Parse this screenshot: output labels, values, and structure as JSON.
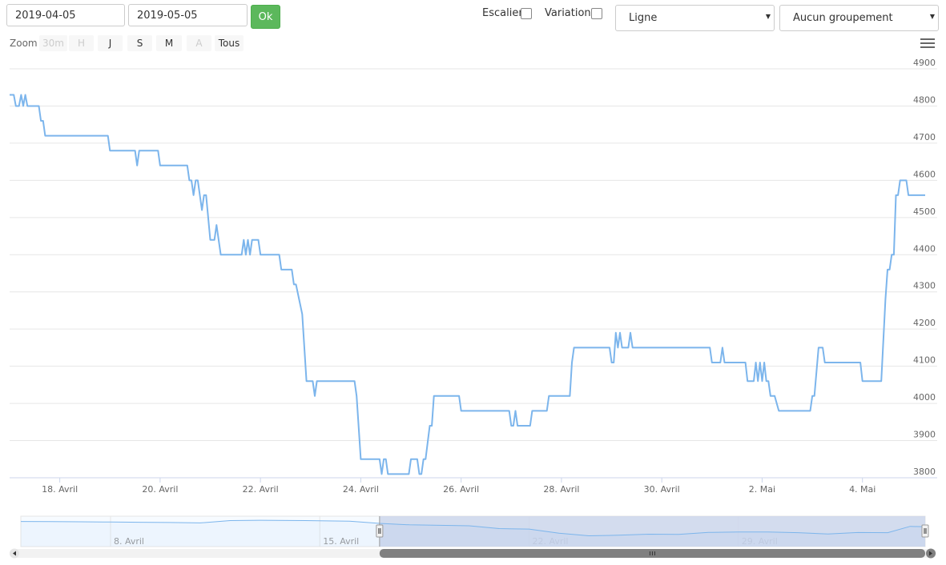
{
  "toolbar": {
    "date_from": "2019-04-05",
    "date_to": "2019-05-05",
    "ok_label": "Ok",
    "escalier_label": "Escalier",
    "variation_label": "Variation",
    "chart_type": "Ligne",
    "grouping": "Aucun groupement"
  },
  "zoom": {
    "label": "Zoom",
    "buttons": [
      {
        "label": "30m",
        "enabled": false
      },
      {
        "label": "H",
        "enabled": false
      },
      {
        "label": "J",
        "enabled": true
      },
      {
        "label": "S",
        "enabled": true
      },
      {
        "label": "M",
        "enabled": true
      },
      {
        "label": "A",
        "enabled": false
      },
      {
        "label": "Tous",
        "enabled": true
      }
    ]
  },
  "colors": {
    "line": "#7cb5ec",
    "navigator_fill": "#ccd6eb",
    "ok_button": "#5cb85c"
  },
  "chart_data": {
    "type": "line",
    "title": "",
    "xlabel": "",
    "ylabel": "",
    "ylim": [
      3800,
      4900
    ],
    "yticks": [
      3800,
      3900,
      4000,
      4100,
      4200,
      4300,
      4400,
      4500,
      4600,
      4700,
      4800,
      4900
    ],
    "xlim": [
      "2019-04-17T00:00",
      "2019-05-05T06:00"
    ],
    "xticks": [
      {
        "date": "2019-04-18",
        "label": "18. Avril"
      },
      {
        "date": "2019-04-20",
        "label": "20. Avril"
      },
      {
        "date": "2019-04-22",
        "label": "22. Avril"
      },
      {
        "date": "2019-04-24",
        "label": "24. Avril"
      },
      {
        "date": "2019-04-26",
        "label": "26. Avril"
      },
      {
        "date": "2019-04-28",
        "label": "28. Avril"
      },
      {
        "date": "2019-04-30",
        "label": "30. Avril"
      },
      {
        "date": "2019-05-02",
        "label": "2. Mai"
      },
      {
        "date": "2019-05-04",
        "label": "4. Mai"
      }
    ],
    "grid": true,
    "legend": "none",
    "series": [
      {
        "points": [
          [
            "2019-04-17T00:00",
            4830
          ],
          [
            "2019-04-17T02:00",
            4830
          ],
          [
            "2019-04-17T03:00",
            4800
          ],
          [
            "2019-04-17T04:30",
            4800
          ],
          [
            "2019-04-17T05:30",
            4830
          ],
          [
            "2019-04-17T06:30",
            4800
          ],
          [
            "2019-04-17T07:30",
            4830
          ],
          [
            "2019-04-17T08:30",
            4800
          ],
          [
            "2019-04-17T14:00",
            4800
          ],
          [
            "2019-04-17T15:00",
            4760
          ],
          [
            "2019-04-17T16:00",
            4760
          ],
          [
            "2019-04-17T17:00",
            4720
          ],
          [
            "2019-04-18T23:00",
            4720
          ],
          [
            "2019-04-19T00:00",
            4680
          ],
          [
            "2019-04-19T12:00",
            4680
          ],
          [
            "2019-04-19T13:00",
            4640
          ],
          [
            "2019-04-19T14:00",
            4680
          ],
          [
            "2019-04-19T23:00",
            4680
          ],
          [
            "2019-04-20T00:00",
            4640
          ],
          [
            "2019-04-20T13:00",
            4640
          ],
          [
            "2019-04-20T14:00",
            4600
          ],
          [
            "2019-04-20T15:00",
            4600
          ],
          [
            "2019-04-20T16:00",
            4560
          ],
          [
            "2019-04-20T17:00",
            4600
          ],
          [
            "2019-04-20T18:00",
            4600
          ],
          [
            "2019-04-20T20:00",
            4520
          ],
          [
            "2019-04-20T21:00",
            4560
          ],
          [
            "2019-04-20T22:00",
            4560
          ],
          [
            "2019-04-21T00:00",
            4440
          ],
          [
            "2019-04-21T02:00",
            4440
          ],
          [
            "2019-04-21T03:00",
            4480
          ],
          [
            "2019-04-21T05:00",
            4400
          ],
          [
            "2019-04-21T15:00",
            4400
          ],
          [
            "2019-04-21T16:00",
            4440
          ],
          [
            "2019-04-21T17:00",
            4400
          ],
          [
            "2019-04-21T18:00",
            4440
          ],
          [
            "2019-04-21T19:00",
            4400
          ],
          [
            "2019-04-21T20:00",
            4440
          ],
          [
            "2019-04-21T23:00",
            4440
          ],
          [
            "2019-04-22T00:00",
            4400
          ],
          [
            "2019-04-22T09:00",
            4400
          ],
          [
            "2019-04-22T10:00",
            4360
          ],
          [
            "2019-04-22T15:00",
            4360
          ],
          [
            "2019-04-22T16:00",
            4320
          ],
          [
            "2019-04-22T17:00",
            4320
          ],
          [
            "2019-04-22T20:00",
            4240
          ],
          [
            "2019-04-22T22:00",
            4060
          ],
          [
            "2019-04-23T01:00",
            4060
          ],
          [
            "2019-04-23T02:00",
            4020
          ],
          [
            "2019-04-23T03:00",
            4060
          ],
          [
            "2019-04-23T21:00",
            4060
          ],
          [
            "2019-04-23T22:00",
            4020
          ],
          [
            "2019-04-24T00:00",
            3850
          ],
          [
            "2019-04-24T09:00",
            3850
          ],
          [
            "2019-04-24T10:00",
            3810
          ],
          [
            "2019-04-24T11:00",
            3850
          ],
          [
            "2019-04-24T12:00",
            3850
          ],
          [
            "2019-04-24T13:00",
            3810
          ],
          [
            "2019-04-24T23:00",
            3810
          ],
          [
            "2019-04-25T00:00",
            3850
          ],
          [
            "2019-04-25T03:00",
            3850
          ],
          [
            "2019-04-25T04:00",
            3810
          ],
          [
            "2019-04-25T05:00",
            3810
          ],
          [
            "2019-04-25T06:00",
            3850
          ],
          [
            "2019-04-25T07:00",
            3850
          ],
          [
            "2019-04-25T09:00",
            3940
          ],
          [
            "2019-04-25T10:00",
            3940
          ],
          [
            "2019-04-25T11:00",
            4020
          ],
          [
            "2019-04-25T23:00",
            4020
          ],
          [
            "2019-04-26T00:00",
            3980
          ],
          [
            "2019-04-26T23:00",
            3980
          ],
          [
            "2019-04-27T00:00",
            3940
          ],
          [
            "2019-04-27T01:00",
            3940
          ],
          [
            "2019-04-27T02:00",
            3980
          ],
          [
            "2019-04-27T03:00",
            3940
          ],
          [
            "2019-04-27T09:00",
            3940
          ],
          [
            "2019-04-27T10:00",
            3980
          ],
          [
            "2019-04-27T17:00",
            3980
          ],
          [
            "2019-04-27T18:00",
            4020
          ],
          [
            "2019-04-28T04:00",
            4020
          ],
          [
            "2019-04-28T05:00",
            4110
          ],
          [
            "2019-04-28T06:00",
            4150
          ],
          [
            "2019-04-28T23:00",
            4150
          ],
          [
            "2019-04-29T00:00",
            4110
          ],
          [
            "2019-04-29T01:00",
            4110
          ],
          [
            "2019-04-29T02:00",
            4190
          ],
          [
            "2019-04-29T03:00",
            4150
          ],
          [
            "2019-04-29T04:00",
            4190
          ],
          [
            "2019-04-29T05:00",
            4150
          ],
          [
            "2019-04-29T08:00",
            4150
          ],
          [
            "2019-04-29T09:00",
            4190
          ],
          [
            "2019-04-29T10:00",
            4150
          ],
          [
            "2019-04-30T23:00",
            4150
          ],
          [
            "2019-05-01T00:00",
            4110
          ],
          [
            "2019-05-01T04:00",
            4110
          ],
          [
            "2019-05-01T05:00",
            4150
          ],
          [
            "2019-05-01T06:00",
            4110
          ],
          [
            "2019-05-01T16:00",
            4110
          ],
          [
            "2019-05-01T17:00",
            4060
          ],
          [
            "2019-05-01T20:00",
            4060
          ],
          [
            "2019-05-01T21:00",
            4110
          ],
          [
            "2019-05-01T22:00",
            4060
          ],
          [
            "2019-05-01T23:00",
            4110
          ],
          [
            "2019-05-02T00:00",
            4060
          ],
          [
            "2019-05-02T01:00",
            4110
          ],
          [
            "2019-05-02T02:00",
            4060
          ],
          [
            "2019-05-02T03:00",
            4060
          ],
          [
            "2019-05-02T04:00",
            4020
          ],
          [
            "2019-05-02T06:00",
            4020
          ],
          [
            "2019-05-02T08:00",
            3980
          ],
          [
            "2019-05-02T23:00",
            3980
          ],
          [
            "2019-05-03T00:00",
            4020
          ],
          [
            "2019-05-03T01:00",
            4020
          ],
          [
            "2019-05-03T03:00",
            4150
          ],
          [
            "2019-05-03T05:00",
            4150
          ],
          [
            "2019-05-03T06:00",
            4110
          ],
          [
            "2019-05-03T23:00",
            4110
          ],
          [
            "2019-05-04T00:00",
            4060
          ],
          [
            "2019-05-04T09:00",
            4060
          ],
          [
            "2019-05-04T11:00",
            4280
          ],
          [
            "2019-05-04T12:00",
            4360
          ],
          [
            "2019-05-04T13:00",
            4360
          ],
          [
            "2019-05-04T14:00",
            4400
          ],
          [
            "2019-05-04T15:00",
            4400
          ],
          [
            "2019-05-04T16:00",
            4560
          ],
          [
            "2019-05-04T17:00",
            4560
          ],
          [
            "2019-05-04T18:00",
            4600
          ],
          [
            "2019-05-04T21:00",
            4600
          ],
          [
            "2019-05-04T22:00",
            4560
          ],
          [
            "2019-05-05T06:00",
            4560
          ]
        ]
      }
    ],
    "navigator": {
      "xlim": [
        "2019-04-05",
        "2019-05-05T06:00"
      ],
      "ylim": [
        3000,
        5400
      ],
      "selected_range": [
        "2019-04-17T00:00",
        "2019-05-05T06:00"
      ],
      "xticks": [
        {
          "date": "2019-04-08",
          "label": "8. Avril"
        },
        {
          "date": "2019-04-15",
          "label": "15. Avril"
        },
        {
          "date": "2019-04-22",
          "label": "22. Avril"
        },
        {
          "date": "2019-04-29",
          "label": "29. Avril"
        }
      ],
      "points": [
        [
          "2019-04-05",
          4980
        ],
        [
          "2019-04-06",
          4970
        ],
        [
          "2019-04-07",
          4960
        ],
        [
          "2019-04-08",
          4940
        ],
        [
          "2019-04-09",
          4920
        ],
        [
          "2019-04-10",
          4900
        ],
        [
          "2019-04-11",
          4870
        ],
        [
          "2019-04-12",
          5050
        ],
        [
          "2019-04-13",
          5080
        ],
        [
          "2019-04-14",
          5060
        ],
        [
          "2019-04-15",
          5040
        ],
        [
          "2019-04-16",
          5000
        ],
        [
          "2019-04-17",
          4830
        ],
        [
          "2019-04-18",
          4720
        ],
        [
          "2019-04-19",
          4680
        ],
        [
          "2019-04-20",
          4640
        ],
        [
          "2019-04-21",
          4420
        ],
        [
          "2019-04-22",
          4380
        ],
        [
          "2019-04-23",
          4060
        ],
        [
          "2019-04-24",
          3850
        ],
        [
          "2019-04-25",
          3900
        ],
        [
          "2019-04-26",
          3980
        ],
        [
          "2019-04-27",
          3960
        ],
        [
          "2019-04-28",
          4120
        ],
        [
          "2019-04-29",
          4150
        ],
        [
          "2019-04-30",
          4150
        ],
        [
          "2019-05-01",
          4100
        ],
        [
          "2019-05-02",
          4000
        ],
        [
          "2019-05-03",
          4110
        ],
        [
          "2019-05-04",
          4100
        ],
        [
          "2019-05-04T18:00",
          4600
        ],
        [
          "2019-05-05T06:00",
          4560
        ]
      ]
    }
  }
}
